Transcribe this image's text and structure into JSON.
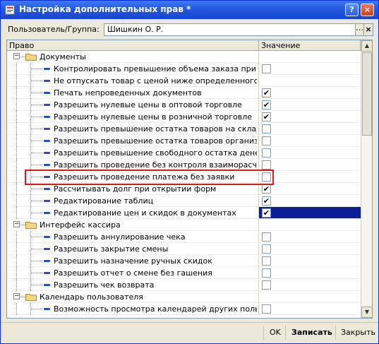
{
  "window": {
    "title": "Настройка дополнительных прав *",
    "help_btn": "?",
    "close_btn": "×"
  },
  "user": {
    "label": "Пользователь/Группа:",
    "value": "Шишкин О. Р.",
    "dots_btn": "...",
    "clear_btn": "×"
  },
  "grid": {
    "columns": {
      "right": "Право",
      "value": "Значение"
    },
    "rows": [
      {
        "type": "group",
        "label": "Документы",
        "expander": "−"
      },
      {
        "type": "item",
        "label": "Контролировать превышение объема заказа при отгр...",
        "checked": false
      },
      {
        "type": "item",
        "label": "Не отпускать товар с ценой ниже определенного типа",
        "checked": null
      },
      {
        "type": "item",
        "label": "Печать непроведенных документов",
        "checked": true
      },
      {
        "type": "item",
        "label": "Разрешить нулевые цены в оптовой торговле",
        "checked": true
      },
      {
        "type": "item",
        "label": "Разрешить нулевые цены в розничной торговле",
        "checked": true
      },
      {
        "type": "item",
        "label": "Разрешить превышение остатка товаров на складе",
        "checked": false
      },
      {
        "type": "item",
        "label": "Разрешить превышение остатка товаров организации",
        "checked": false
      },
      {
        "type": "item",
        "label": "Разрешить превышение свободного остатка денежны...",
        "checked": false
      },
      {
        "type": "item",
        "label": "Разрешить проведение без контроля взаиморасчетов",
        "checked": false
      },
      {
        "type": "item",
        "label": "Разрешить проведение платежа без заявки",
        "checked": false
      },
      {
        "type": "item",
        "label": "Рассчитывать долг при открытии форм",
        "checked": true
      },
      {
        "type": "item",
        "label": "Редактирование таблиц",
        "checked": true
      },
      {
        "type": "item",
        "label": "Редактирование цен и скидок в документах",
        "checked": true,
        "selected": true
      },
      {
        "type": "group",
        "label": "Интерфейс кассира",
        "expander": "−"
      },
      {
        "type": "item",
        "label": "Разрешить аннулирование чека",
        "checked": false
      },
      {
        "type": "item",
        "label": "Разрешить закрытие смены",
        "checked": false
      },
      {
        "type": "item",
        "label": "Разрешить назначение ручных скидок",
        "checked": false
      },
      {
        "type": "item",
        "label": "Разрешить отчет о смене без гашения",
        "checked": false
      },
      {
        "type": "item",
        "label": "Разрешить чек возврата",
        "checked": false
      },
      {
        "type": "group",
        "label": "Календарь пользователя",
        "expander": "−"
      },
      {
        "type": "item",
        "label": "Возможность просмотра календарей других пользова...",
        "checked": false
      }
    ],
    "check_mark": "✔"
  },
  "footer": {
    "ok": "OK",
    "save": "Записать",
    "close": "Закрыть"
  },
  "colors": {
    "selection": "#0a1e96",
    "highlight": "#e01818",
    "titlebar": "#2358e0"
  }
}
